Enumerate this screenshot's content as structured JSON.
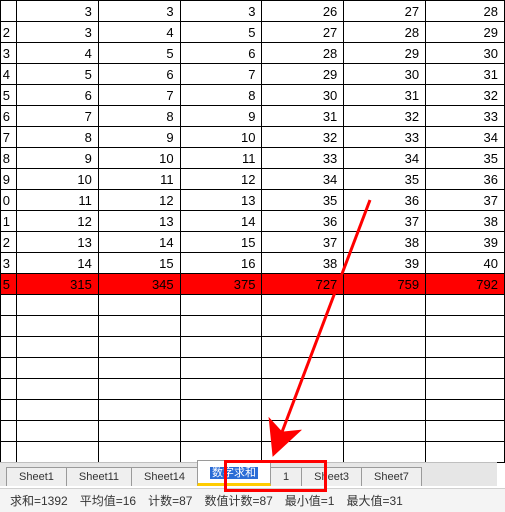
{
  "grid": {
    "rows": [
      {
        "c": [
          "",
          "3",
          "3",
          "3",
          "26",
          "27",
          "28"
        ]
      },
      {
        "c": [
          "2",
          "3",
          "4",
          "5",
          "27",
          "28",
          "29"
        ]
      },
      {
        "c": [
          "3",
          "4",
          "5",
          "6",
          "28",
          "29",
          "30"
        ]
      },
      {
        "c": [
          "4",
          "5",
          "6",
          "7",
          "29",
          "30",
          "31"
        ]
      },
      {
        "c": [
          "5",
          "6",
          "7",
          "8",
          "30",
          "31",
          "32"
        ]
      },
      {
        "c": [
          "6",
          "7",
          "8",
          "9",
          "31",
          "32",
          "33"
        ]
      },
      {
        "c": [
          "7",
          "8",
          "9",
          "10",
          "32",
          "33",
          "34"
        ]
      },
      {
        "c": [
          "8",
          "9",
          "10",
          "11",
          "33",
          "34",
          "35"
        ]
      },
      {
        "c": [
          "9",
          "10",
          "11",
          "12",
          "34",
          "35",
          "36"
        ]
      },
      {
        "c": [
          "0",
          "11",
          "12",
          "13",
          "35",
          "36",
          "37"
        ]
      },
      {
        "c": [
          "1",
          "12",
          "13",
          "14",
          "36",
          "37",
          "38"
        ]
      },
      {
        "c": [
          "2",
          "13",
          "14",
          "15",
          "37",
          "38",
          "39"
        ]
      },
      {
        "c": [
          "3",
          "14",
          "15",
          "16",
          "38",
          "39",
          "40"
        ]
      }
    ],
    "sum": {
      "c": [
        "5",
        "315",
        "345",
        "375",
        "727",
        "759",
        "792"
      ]
    },
    "empty_rows": 8
  },
  "tabs": [
    {
      "label": "Sheet1",
      "active": false
    },
    {
      "label": "Sheet11",
      "active": false
    },
    {
      "label": "Sheet14",
      "active": false
    },
    {
      "label": "数字求和",
      "active": true
    },
    {
      "label": "1",
      "active": false
    },
    {
      "label": "Sheet3",
      "active": false
    },
    {
      "label": "Sheet7",
      "active": false
    }
  ],
  "status": {
    "sum": "求和=1392",
    "avg": "平均值=16",
    "count": "计数=87",
    "ncount": "数值计数=87",
    "min": "最小值=1",
    "max": "最大值=31"
  }
}
